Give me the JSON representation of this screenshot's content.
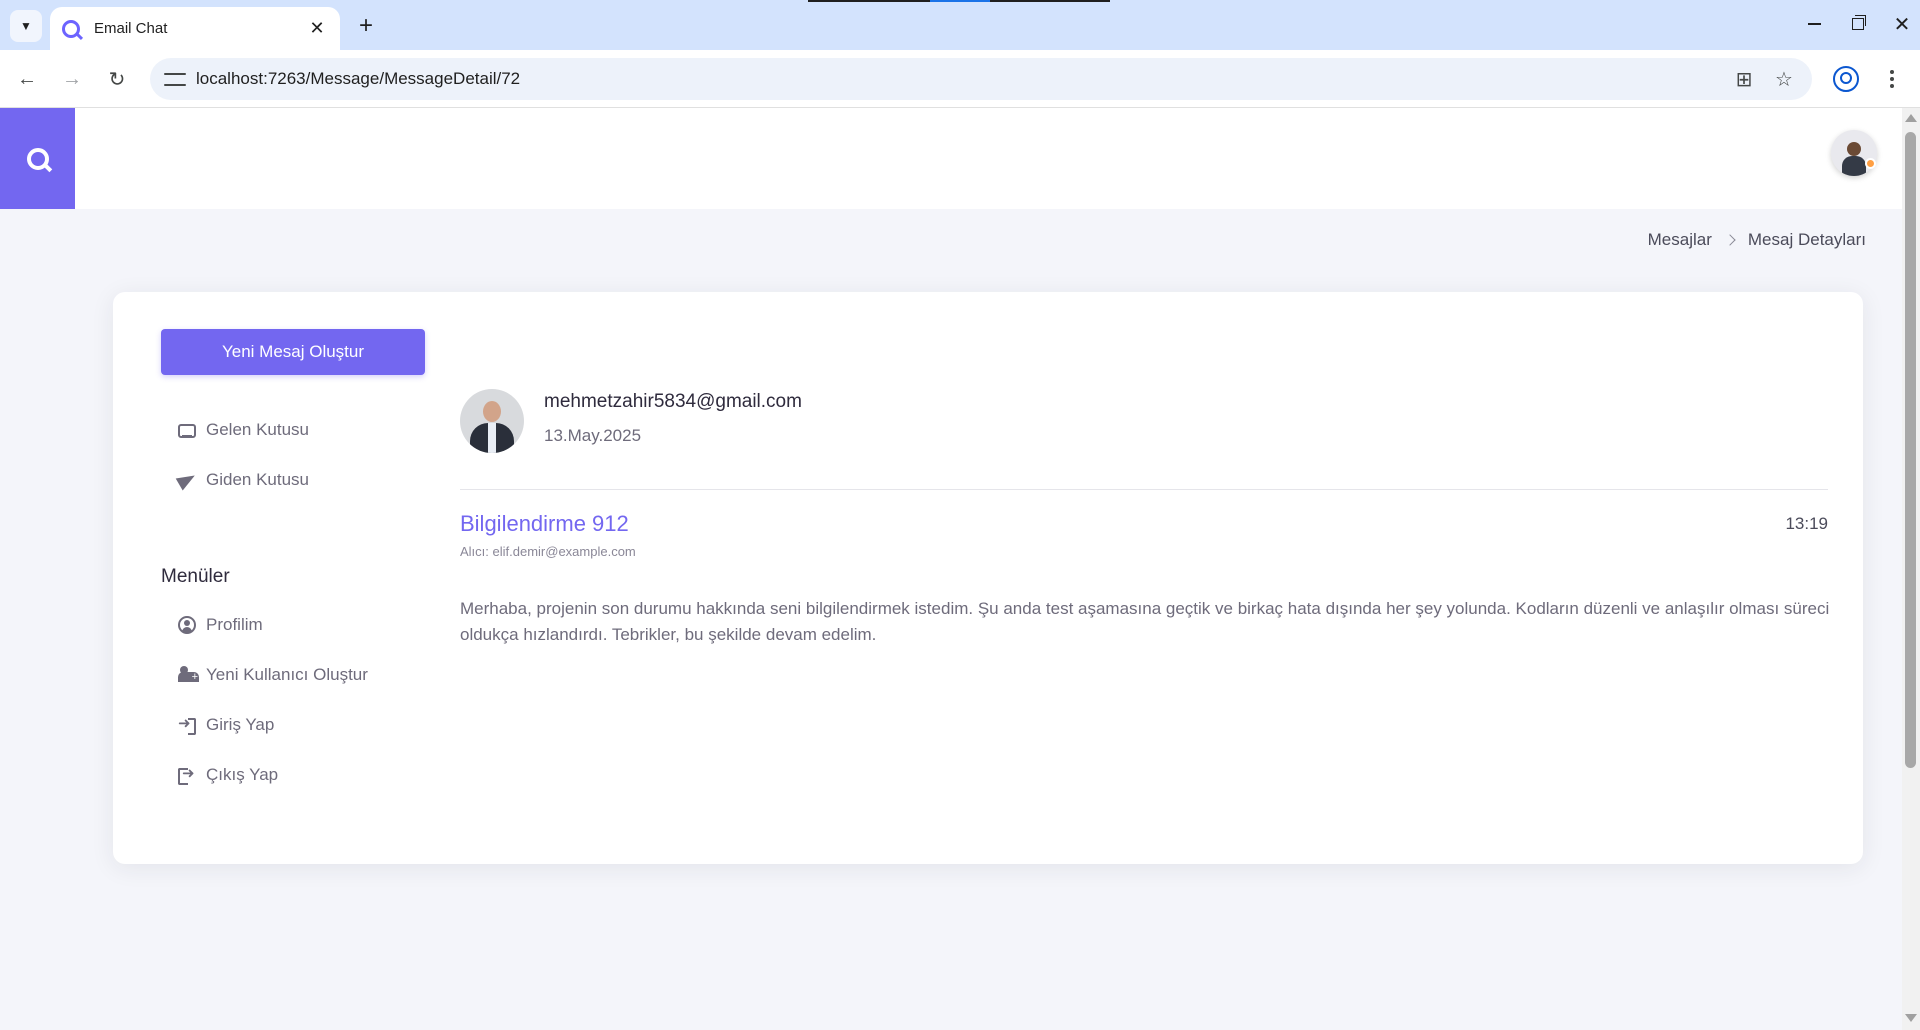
{
  "browser": {
    "tab_title": "Email Chat",
    "url": "localhost:7263/Message/MessageDetail/72"
  },
  "breadcrumb": {
    "items": [
      "Mesajlar",
      "Mesaj Detayları"
    ]
  },
  "sidebar": {
    "compose_label": "Yeni Mesaj Oluştur",
    "mail_items": [
      {
        "label": "Gelen Kutusu",
        "icon": "inbox-icon"
      },
      {
        "label": "Giden Kutusu",
        "icon": "send-icon"
      }
    ],
    "menu_heading": "Menüler",
    "menu_items": [
      {
        "label": "Profilim",
        "icon": "user-circle-icon"
      },
      {
        "label": "Yeni Kullanıcı Oluştur",
        "icon": "user-plus-icon"
      },
      {
        "label": "Giriş Yap",
        "icon": "sign-in-icon"
      },
      {
        "label": "Çıkış Yap",
        "icon": "sign-out-icon"
      }
    ]
  },
  "message": {
    "sender_email": "mehmetzahir5834@gmail.com",
    "date": "13.May.2025",
    "subject": "Bilgilendirme 912",
    "time": "13:19",
    "recipient": "Alıcı: elif.demir@example.com",
    "body": "Merhaba, projenin son durumu hakkında seni bilgilendirmek istedim. Şu anda test aşamasına geçtik ve birkaç hata dışında her şey yolunda. Kodların düzenli ve anlaşılır olması süreci oldukça hızlandırdı. Tebrikler, bu şekilde devam edelim."
  },
  "colors": {
    "accent": "#7367f0",
    "status_dot": "#ff9f43"
  }
}
